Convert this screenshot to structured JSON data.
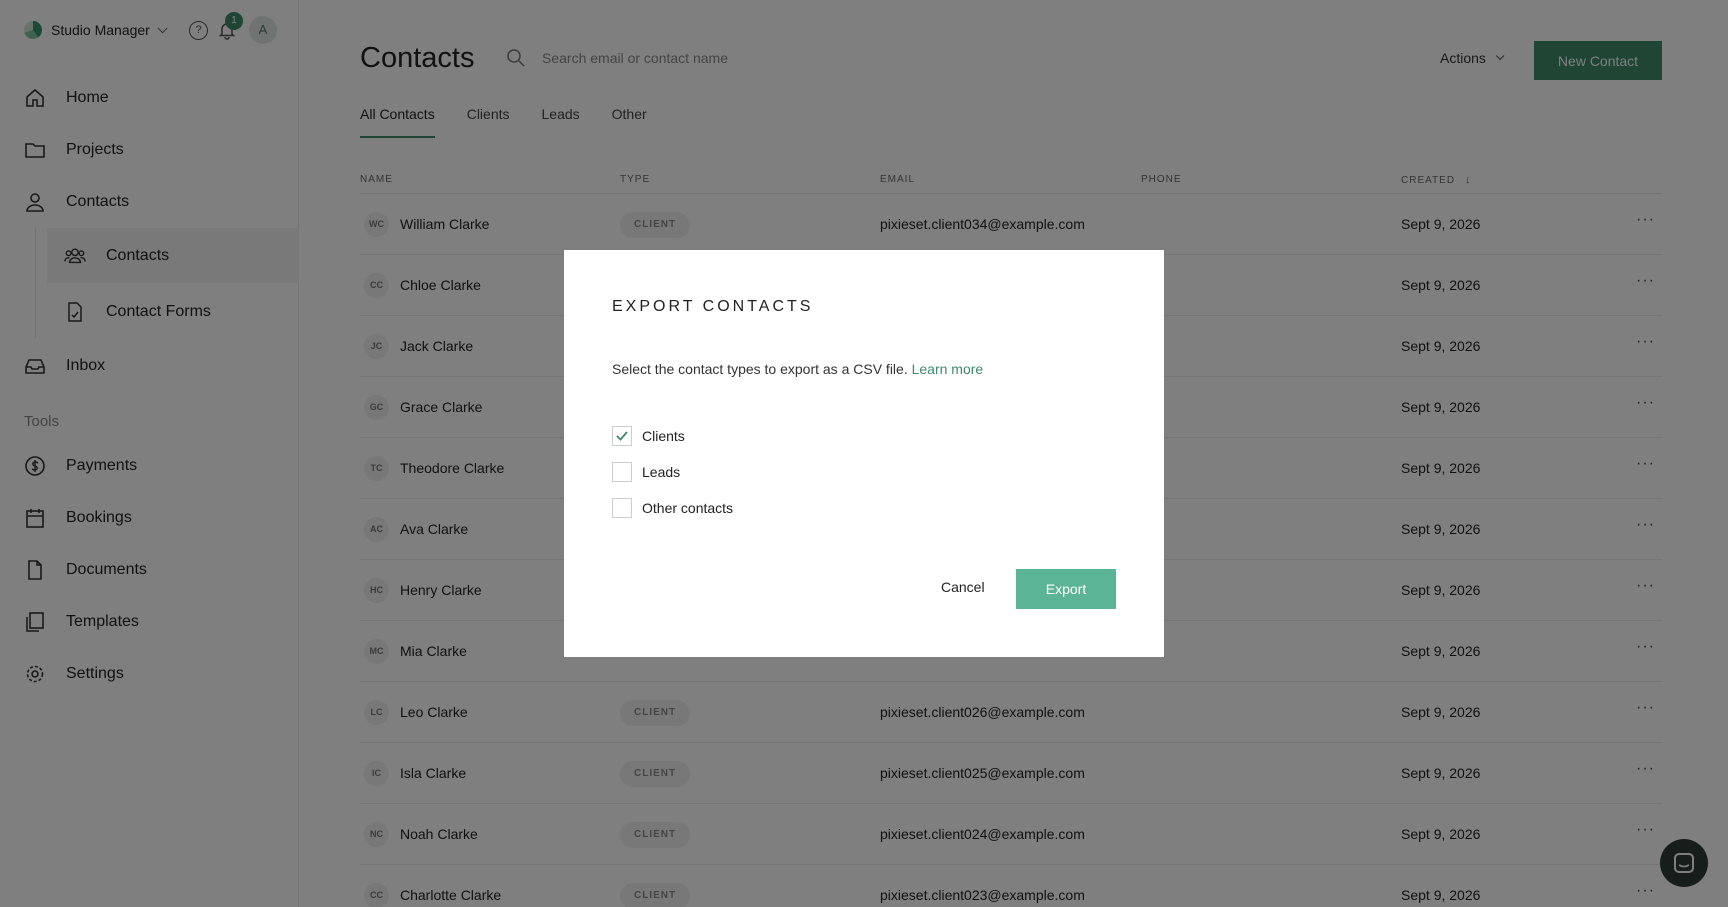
{
  "app": {
    "studio_name": "Studio Manager",
    "notification_count": "1",
    "avatar_letter": "A",
    "help_glyph": "?"
  },
  "sidebar": {
    "items": [
      {
        "label": "Home",
        "icon": "home-icon"
      },
      {
        "label": "Projects",
        "icon": "folder-icon"
      },
      {
        "label": "Contacts",
        "icon": "person-icon"
      },
      {
        "label": "Contacts",
        "icon": "people-icon"
      },
      {
        "label": "Contact Forms",
        "icon": "form-icon"
      },
      {
        "label": "Inbox",
        "icon": "inbox-icon"
      },
      {
        "label": "Payments",
        "icon": "dollar-icon"
      },
      {
        "label": "Bookings",
        "icon": "calendar-icon"
      },
      {
        "label": "Documents",
        "icon": "document-icon"
      },
      {
        "label": "Templates",
        "icon": "templates-icon"
      },
      {
        "label": "Settings",
        "icon": "gear-icon"
      }
    ],
    "tools_label": "Tools"
  },
  "header": {
    "title": "Contacts",
    "search_placeholder": "Search email or contact name",
    "actions_label": "Actions",
    "new_contact_label": "New Contact"
  },
  "tabs": [
    {
      "label": "All Contacts",
      "active": true
    },
    {
      "label": "Clients"
    },
    {
      "label": "Leads"
    },
    {
      "label": "Other"
    }
  ],
  "table": {
    "columns": [
      "NAME",
      "TYPE",
      "EMAIL",
      "PHONE",
      "CREATED"
    ],
    "rows": [
      {
        "initials": "WC",
        "name": "William Clarke",
        "type": "CLIENT",
        "email": "pixieset.client034@example.com",
        "created": "Sept 9, 2026"
      },
      {
        "initials": "CC",
        "name": "Chloe Clarke",
        "type": "",
        "email": "",
        "created": "Sept 9, 2026"
      },
      {
        "initials": "JC",
        "name": "Jack Clarke",
        "type": "",
        "email": "",
        "created": "Sept 9, 2026"
      },
      {
        "initials": "GC",
        "name": "Grace Clarke",
        "type": "",
        "email": "",
        "created": "Sept 9, 2026"
      },
      {
        "initials": "TC",
        "name": "Theodore Clarke",
        "type": "",
        "email": "",
        "created": "Sept 9, 2026"
      },
      {
        "initials": "AC",
        "name": "Ava Clarke",
        "type": "",
        "email": "",
        "created": "Sept 9, 2026"
      },
      {
        "initials": "HC",
        "name": "Henry Clarke",
        "type": "",
        "email": "",
        "created": "Sept 9, 2026"
      },
      {
        "initials": "MC",
        "name": "Mia Clarke",
        "type": "",
        "email": "",
        "created": "Sept 9, 2026"
      },
      {
        "initials": "LC",
        "name": "Leo Clarke",
        "type": "CLIENT",
        "email": "pixieset.client026@example.com",
        "created": "Sept 9, 2026"
      },
      {
        "initials": "IC",
        "name": "Isla Clarke",
        "type": "CLIENT",
        "email": "pixieset.client025@example.com",
        "created": "Sept 9, 2026"
      },
      {
        "initials": "NC",
        "name": "Noah Clarke",
        "type": "CLIENT",
        "email": "pixieset.client024@example.com",
        "created": "Sept 9, 2026"
      },
      {
        "initials": "CC",
        "name": "Charlotte Clarke",
        "type": "CLIENT",
        "email": "pixieset.client023@example.com",
        "created": "Sept 9, 2026"
      }
    ],
    "more_glyph": "···"
  },
  "modal": {
    "title": "EXPORT CONTACTS",
    "description": "Select the contact types to export as a CSV file.",
    "learn_more": "Learn more",
    "options": [
      {
        "label": "Clients",
        "checked": true
      },
      {
        "label": "Leads",
        "checked": false
      },
      {
        "label": "Other contacts",
        "checked": false
      }
    ],
    "cancel_label": "Cancel",
    "export_label": "Export"
  },
  "colors": {
    "accent": "#3e8a6a",
    "export_button": "#5bb496",
    "overlay": "rgba(0,0,0,0.5)"
  }
}
